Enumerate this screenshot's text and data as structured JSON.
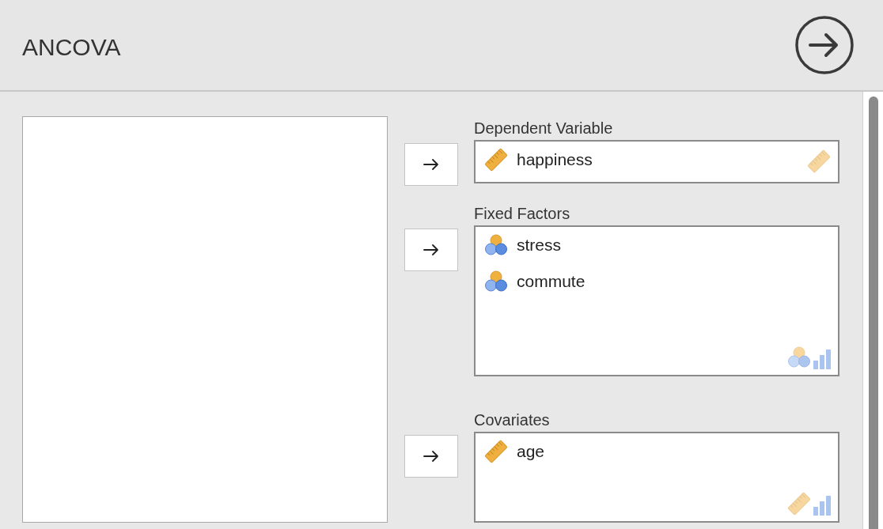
{
  "title": "ANCOVA",
  "targets": [
    {
      "label": "Dependent Variable",
      "variables": [
        {
          "name": "happiness",
          "kind": "continuous"
        }
      ],
      "accepts": [
        {
          "kind": "continuous"
        }
      ]
    },
    {
      "label": "Fixed Factors",
      "variables": [
        {
          "name": "stress",
          "kind": "nominal"
        },
        {
          "name": "commute",
          "kind": "nominal"
        }
      ],
      "accepts": [
        {
          "kind": "nominal"
        },
        {
          "kind": "ordinal"
        }
      ]
    },
    {
      "label": "Covariates",
      "variables": [
        {
          "name": "age",
          "kind": "continuous"
        }
      ],
      "accepts": [
        {
          "kind": "continuous"
        },
        {
          "kind": "ordinal"
        }
      ]
    }
  ]
}
